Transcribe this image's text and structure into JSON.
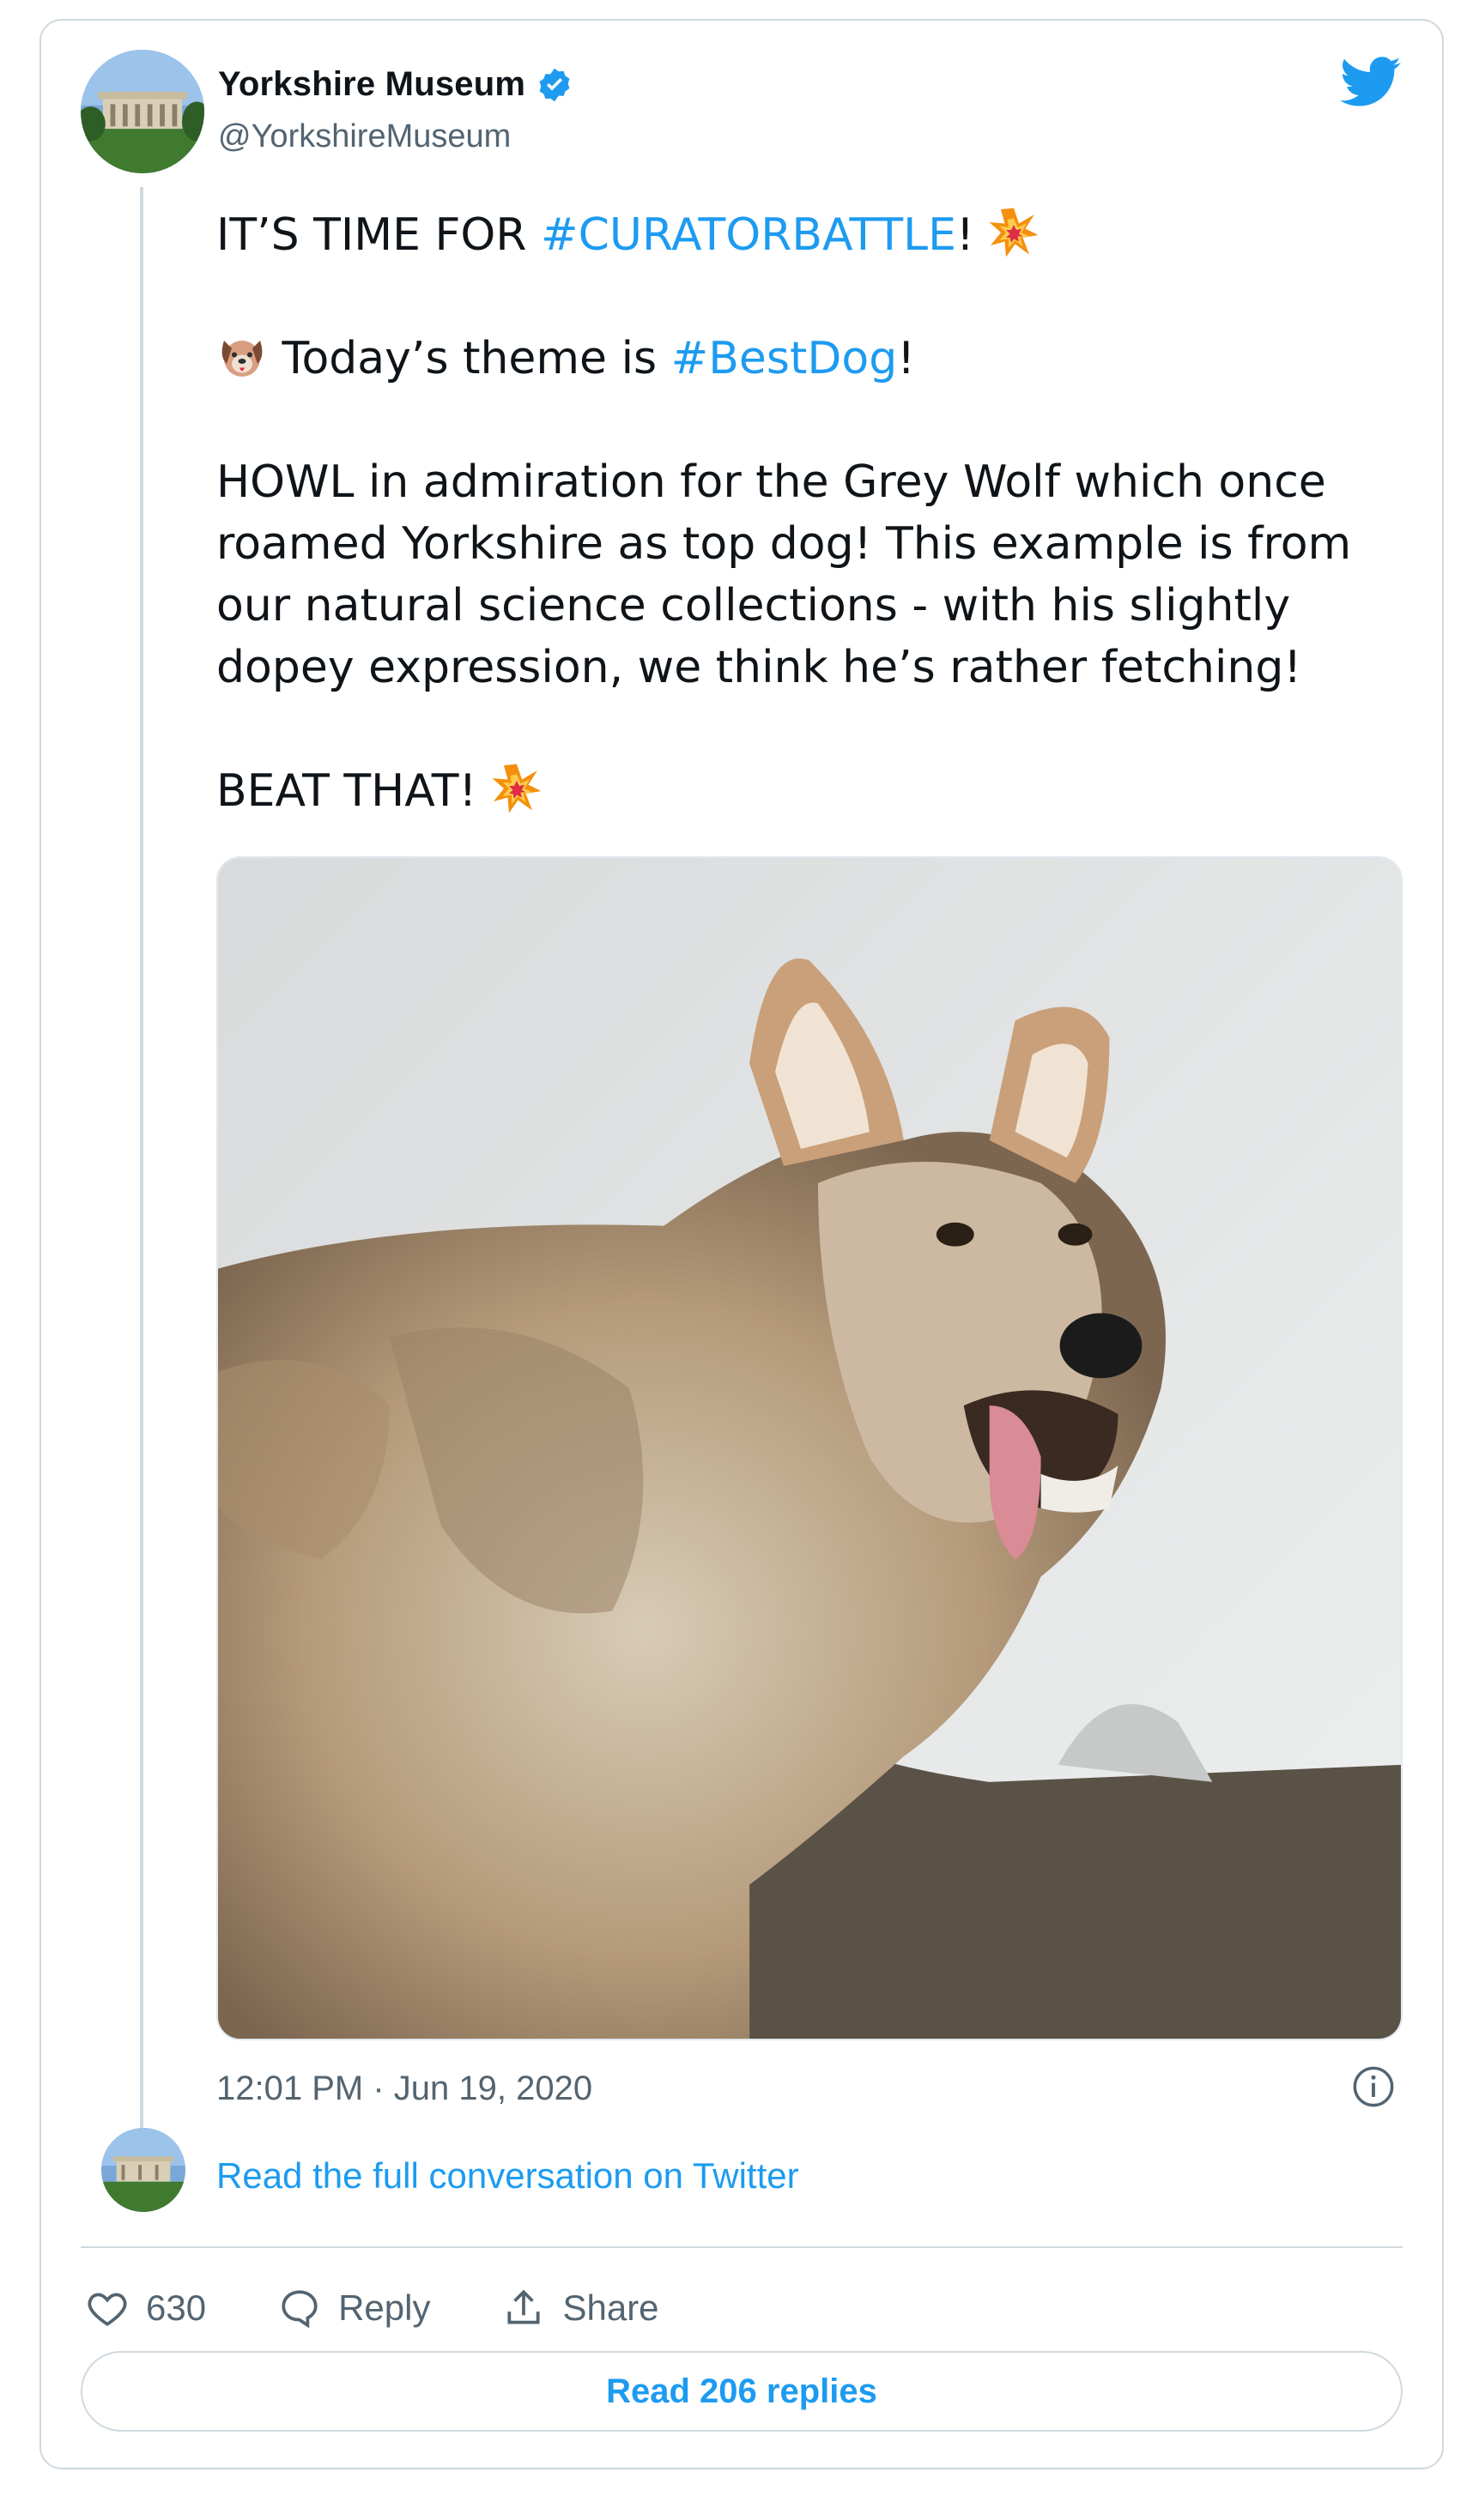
{
  "account": {
    "display_name": "Yorkshire Museum",
    "handle": "@YorkshireMuseum",
    "verified": true,
    "avatar_icon": "museum-building-avatar"
  },
  "header": {
    "logo_icon": "twitter-bird-icon"
  },
  "tweet": {
    "line1_prefix": "IT’S TIME FOR ",
    "line1_hashtag": "#CURATORBATTLE",
    "line1_suffix": "!",
    "line2_prefix": " Today’s theme is ",
    "line2_hashtag": "#BestDog",
    "line2_suffix": "!",
    "paragraph3": "HOWL in admiration for the Grey Wolf which once roamed Yorkshire as top dog! This example is from our natural science collections - with his slightly dopey expression, we think he’s rather fetching!",
    "line4": "BEAT THAT! ",
    "emojis": [
      "collision-emoji",
      "dog-face-emoji"
    ],
    "media_alt": "grey-wolf-photo"
  },
  "timestamp": "12:01 PM · Jun 19, 2020",
  "conversation_link": "Read the full conversation on Twitter",
  "actions": {
    "like_count": "630",
    "reply_label": "Reply",
    "share_label": "Share"
  },
  "read_replies_label": "Read 206 replies",
  "colors": {
    "link": "#1d9bf0",
    "text": "#0f1419",
    "secondary": "#536471",
    "border": "#cfd9de"
  }
}
